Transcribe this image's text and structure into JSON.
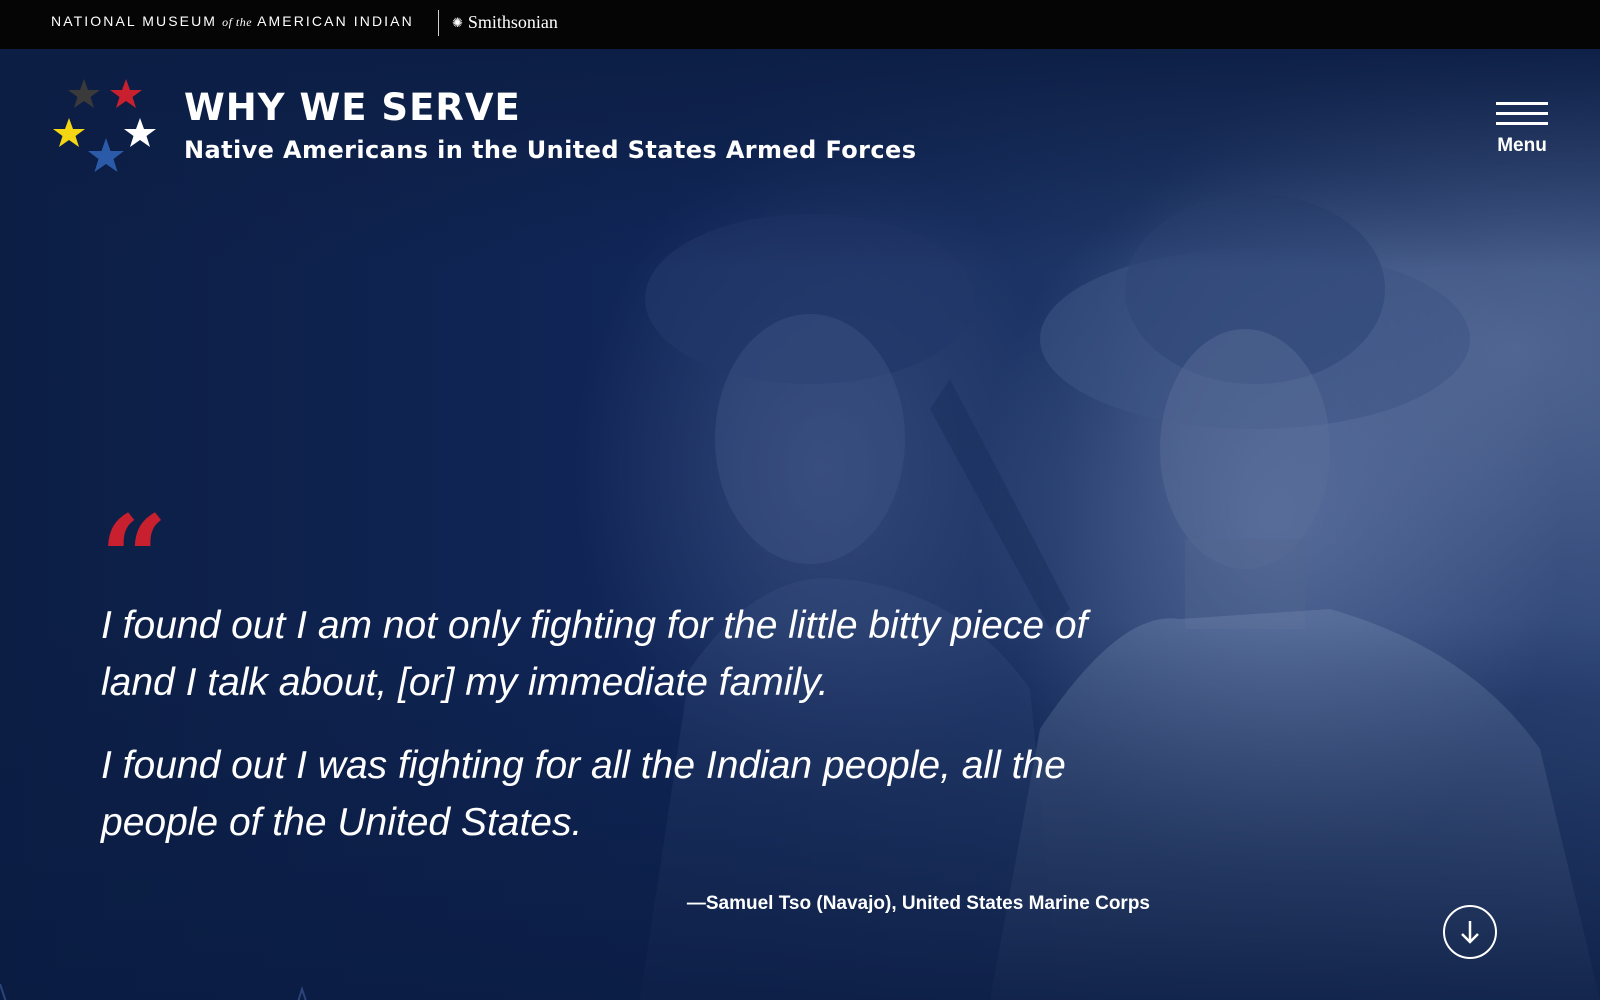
{
  "topbar": {
    "nmai_left": "NATIONAL MUSEUM",
    "nmai_of_the": "of the",
    "nmai_right": "AMERICAN INDIAN",
    "smithsonian_label": "Smithsonian",
    "smithsonian_icon": "sun-burst-icon"
  },
  "header": {
    "title": "WHY WE SERVE",
    "subtitle": "Native Americans in the United States Armed Forces",
    "logo_star_colors": [
      "#3a3a3a",
      "#c8202e",
      "#f4d614",
      "#ffffff",
      "#2a5aa8"
    ],
    "menu_label": "Menu",
    "menu_icon": "hamburger-icon"
  },
  "quote": {
    "mark": "“",
    "paragraph_1": "I found out I am not only fighting for the little bitty piece of land I talk about, [or] my immediate family.",
    "paragraph_2": "I found out I was fighting for all the Indian people, all the people of the United States.",
    "attribution": "—Samuel Tso (Navajo), United States Marine Corps"
  },
  "scroll_button": {
    "icon": "arrow-down-icon"
  },
  "colors": {
    "topbar_bg": "#050505",
    "hero_bg": "#0d1f45",
    "accent_red": "#c8202e",
    "text": "#ffffff"
  }
}
